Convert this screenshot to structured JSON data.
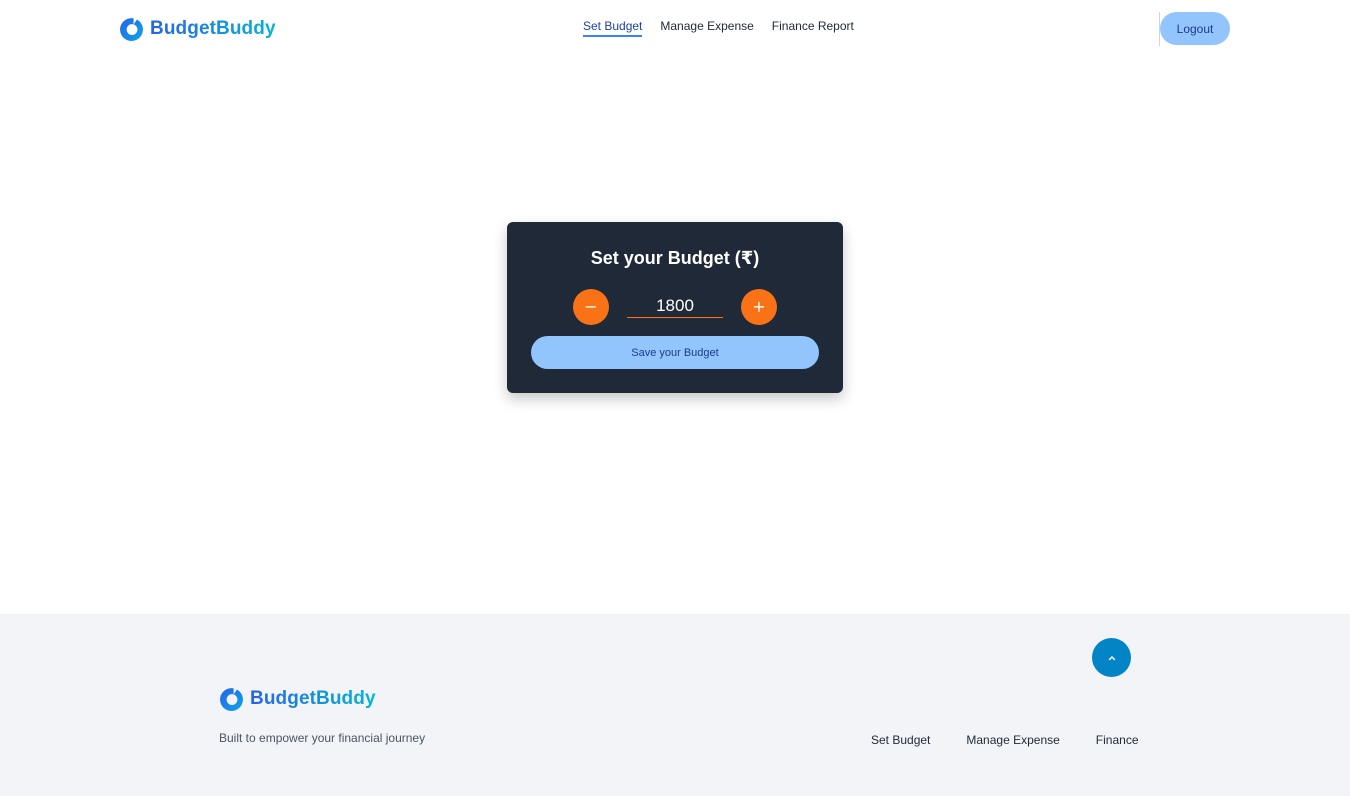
{
  "brand": {
    "name": "BudgetBuddy",
    "gradient_start": "#2563eb",
    "gradient_end": "#06b6d4",
    "icon": "logo-ring-icon"
  },
  "nav": {
    "items": [
      {
        "label": "Set Budget",
        "active": true
      },
      {
        "label": "Manage Expense",
        "active": false
      },
      {
        "label": "Finance Report",
        "active": false
      }
    ]
  },
  "header": {
    "logout_label": "Logout"
  },
  "budget_card": {
    "title": "Set your Budget (₹)",
    "decrement_symbol": "−",
    "increment_symbol": "+",
    "value": "1800",
    "save_label": "Save your Budget"
  },
  "footer": {
    "tagline": "Built to empower your financial journey",
    "scroll_top_icon": "chevron-up-icon",
    "links": [
      "Set Budget",
      "Manage Expense",
      "Finance"
    ]
  },
  "colors": {
    "accent_orange": "#f97316",
    "button_light_blue": "#93c5fd",
    "card_dark": "#1f2937",
    "scroll_top_blue": "#0284c7",
    "footer_bg": "#f2f4f7"
  }
}
